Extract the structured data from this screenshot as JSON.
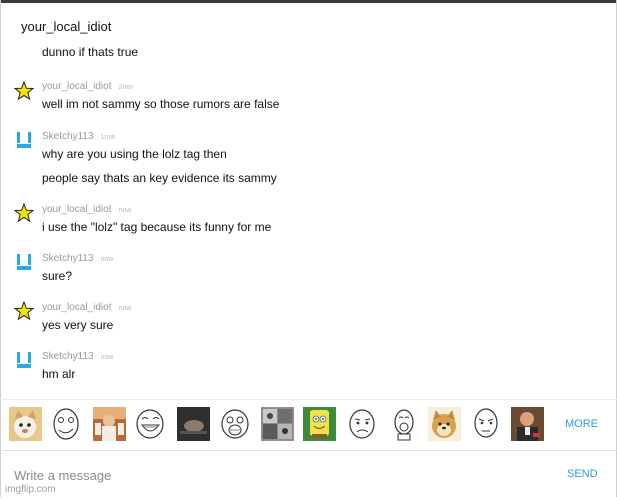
{
  "chat": {
    "title": "your_local_idiot"
  },
  "messages": [
    {
      "user": "",
      "time": "",
      "text": "dunno if thats true",
      "avatar": "none"
    },
    {
      "user": "your_local_idiot",
      "time": "2min",
      "text": "well im not sammy so those rumors are false",
      "avatar": "star-icon"
    },
    {
      "user": "Sketchy113",
      "time": "1min",
      "text": "why are you using the lolz tag then",
      "avatar": "blue-bracket-icon"
    },
    {
      "user": "",
      "time": "",
      "text": "people say thats an key evidence its sammy",
      "avatar": "none"
    },
    {
      "user": "your_local_idiot",
      "time": "now",
      "text": "i use the \"lolz\" tag because its funny for me",
      "avatar": "star-icon"
    },
    {
      "user": "Sketchy113",
      "time": "now",
      "text": "sure?",
      "avatar": "blue-bracket-icon"
    },
    {
      "user": "your_local_idiot",
      "time": "now",
      "text": "yes very sure",
      "avatar": "star-icon"
    },
    {
      "user": "Sketchy113",
      "time": "now",
      "text": "hm alr",
      "avatar": "blue-bracket-icon"
    }
  ],
  "emoji_bar": {
    "items": [
      "cat-face-icon",
      "derp-face-icon",
      "jesus-meme-icon",
      "happy-troll-face-icon",
      "dark-meme-icon",
      "angry-rage-face-icon",
      "cat-collage-icon",
      "spongebob-icon",
      "sad-face-icon",
      "lol-face-icon",
      "doge-icon",
      "okay-face-icon",
      "man-meme-icon"
    ],
    "more_label": "MORE"
  },
  "composer": {
    "placeholder": "Write a message",
    "value": "",
    "send_label": "SEND"
  },
  "footer": {
    "watermark": "imgflip.com"
  },
  "colors": {
    "accent": "#2a9fd6",
    "star": "#f2e600",
    "bracket": "#29a8e0"
  }
}
